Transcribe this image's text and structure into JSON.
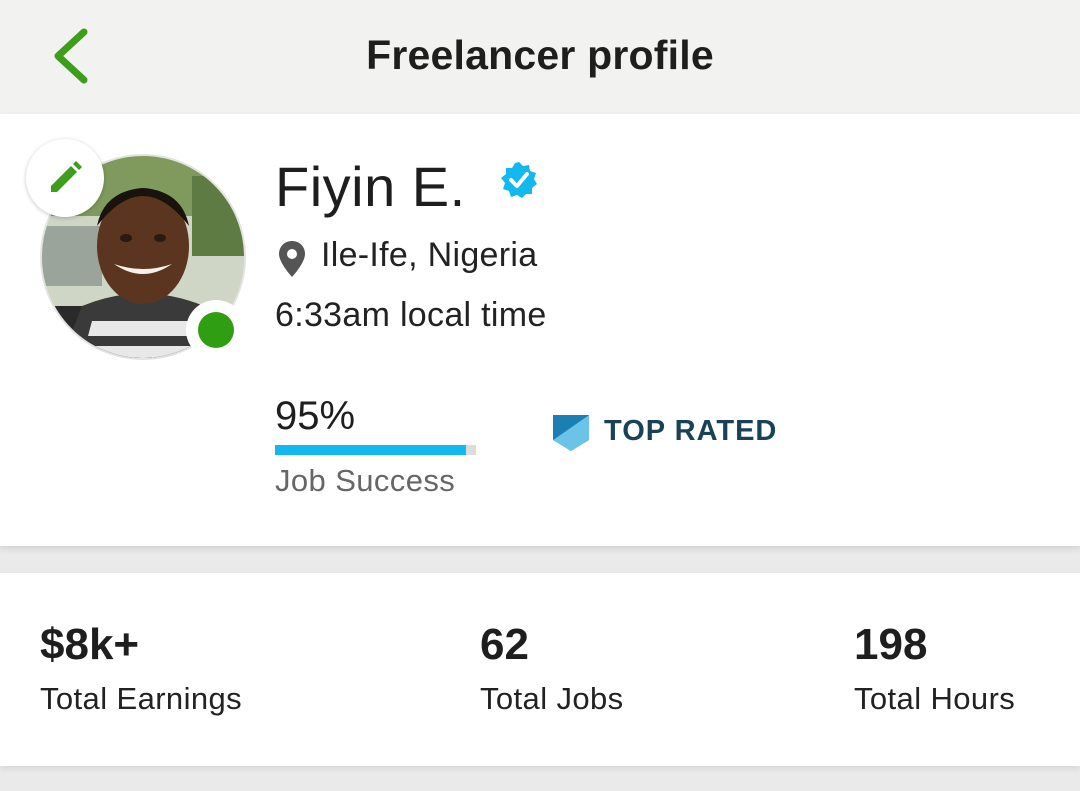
{
  "header": {
    "title": "Freelancer profile",
    "back_icon": "chevron-left-icon",
    "accent_color": "#3c9e1a"
  },
  "profile": {
    "name": "Fiyin E.",
    "verified": true,
    "location": "Ile-Ife, Nigeria",
    "local_time": "6:33am local time",
    "online": true,
    "job_success": {
      "value_text": "95%",
      "value": 0.95,
      "label": "Job Success",
      "bar_color": "#13b8f0"
    },
    "badge": {
      "label": "TOP RATED",
      "icon": "top-rated-shield-icon",
      "color": "#1a4257"
    }
  },
  "stats": [
    {
      "value": "$8k+",
      "label": "Total Earnings"
    },
    {
      "value": "62",
      "label": "Total Jobs"
    },
    {
      "value": "198",
      "label": "Total Hours"
    }
  ]
}
